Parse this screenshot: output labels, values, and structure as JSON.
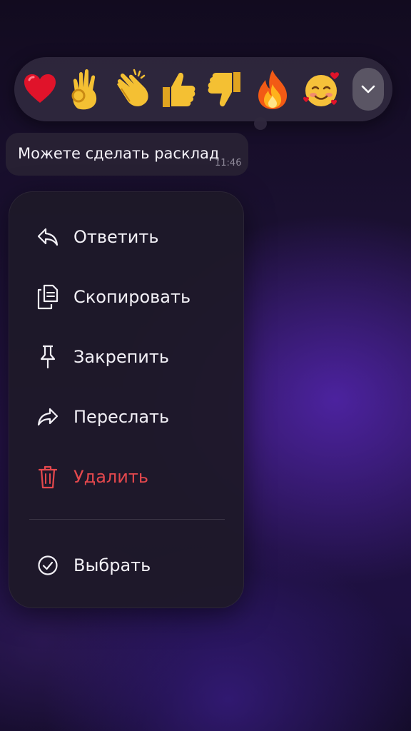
{
  "reactions": [
    {
      "name": "heart",
      "glyph": "❤️"
    },
    {
      "name": "ok-hand",
      "glyph": "👌"
    },
    {
      "name": "clapping-hands",
      "glyph": "👏"
    },
    {
      "name": "thumbs-up",
      "glyph": "👍"
    },
    {
      "name": "thumbs-down",
      "glyph": "👎"
    },
    {
      "name": "fire",
      "glyph": "🔥"
    },
    {
      "name": "smiling-face-with-hearts",
      "glyph": "🥰"
    }
  ],
  "message": {
    "text": "Можете сделать расклад",
    "time": "11:46"
  },
  "menu": {
    "reply": "Ответить",
    "copy": "Скопировать",
    "pin": "Закрепить",
    "forward": "Переслать",
    "delete": "Удалить",
    "select": "Выбрать"
  },
  "colors": {
    "danger": "#e5484d",
    "accent_glow": "#5a28be"
  },
  "icons": {
    "reply": "reply-arrow-icon",
    "copy": "copy-documents-icon",
    "pin": "pushpin-icon",
    "forward": "forward-arrow-icon",
    "delete": "trash-icon",
    "select": "check-circle-icon",
    "expand": "chevron-down-icon"
  }
}
